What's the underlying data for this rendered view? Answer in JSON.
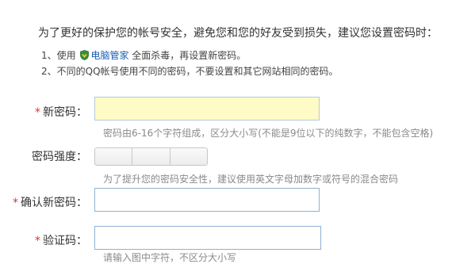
{
  "intro": "为了更好的保护您的帐号安全，避免您和您的好友受到损失，建议您设置密码时：",
  "tips": {
    "tip1_before": "1、使用",
    "tip1_link": "电脑管家",
    "tip1_after": " 全面杀毒，再设置新密码。",
    "tip2": "2、不同的QQ帐号使用不同的密码，不要设置和其它网站相同的密码。"
  },
  "form": {
    "required_mark": "*",
    "new_password": {
      "label": "新密码：",
      "value": "",
      "hint": "密码由6-16个字符组成，区分大小写(不能是9位以下的纯数字，不能包含空格)"
    },
    "strength": {
      "label": "密码强度：",
      "hint": "为了提升您的密码安全性，建议使用英文字母加数字或符号的混合密码"
    },
    "confirm_password": {
      "label": "确认新密码：",
      "value": ""
    },
    "captcha": {
      "label": "验证码：",
      "value": "",
      "hint": "请输入图中字符，不区分大小写"
    }
  },
  "colors": {
    "focused_input_bg": "#fefbc6",
    "required_star": "#e0352b",
    "link": "#1a5fb4"
  }
}
